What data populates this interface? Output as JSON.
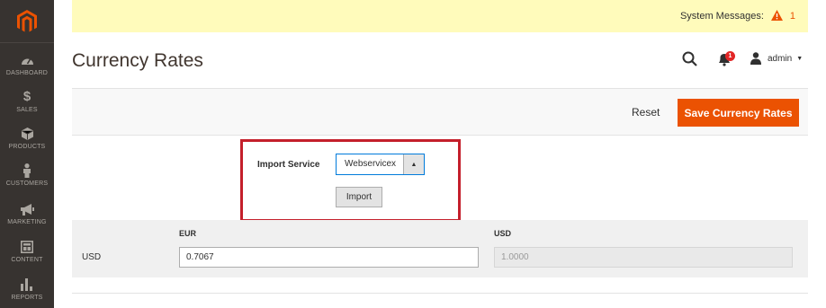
{
  "sidebar": {
    "items": [
      {
        "label": "DASHBOARD",
        "icon": "dashboard-icon"
      },
      {
        "label": "SALES",
        "icon": "dollar-icon"
      },
      {
        "label": "PRODUCTS",
        "icon": "cube-icon"
      },
      {
        "label": "CUSTOMERS",
        "icon": "person-icon"
      },
      {
        "label": "MARKETING",
        "icon": "megaphone-icon"
      },
      {
        "label": "CONTENT",
        "icon": "layout-icon"
      },
      {
        "label": "REPORTS",
        "icon": "bar-chart-icon"
      }
    ]
  },
  "system_messages": {
    "label": "System Messages:",
    "count": "1"
  },
  "header": {
    "title": "Currency Rates",
    "notifications_count": "1",
    "user": "admin"
  },
  "actions": {
    "reset": "Reset",
    "save": "Save Currency Rates"
  },
  "import": {
    "label": "Import Service",
    "service": "Webservicex",
    "button": "Import"
  },
  "rates": {
    "columns": [
      "EUR",
      "USD"
    ],
    "row_label": "USD",
    "values": [
      "0.7067",
      "1.0000"
    ]
  },
  "colors": {
    "accent": "#eb5202",
    "sidebar": "#373330",
    "highlight": "#c41f2b",
    "system_bar": "#fffbbb"
  }
}
